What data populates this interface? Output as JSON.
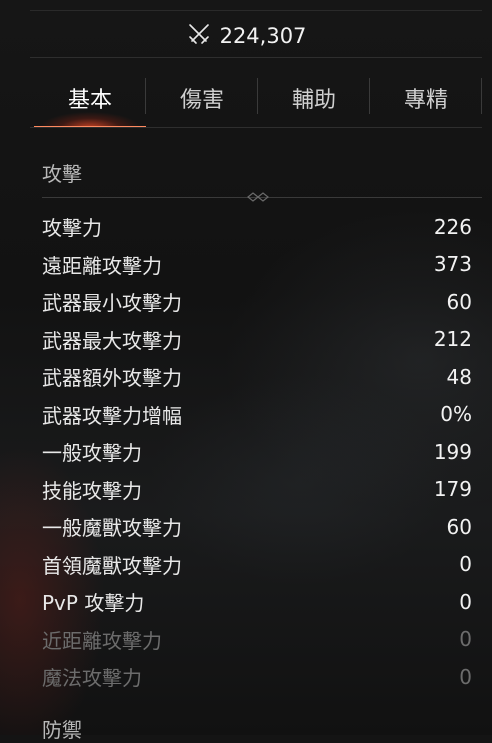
{
  "power": {
    "value": "224,307",
    "icon": "crossed-swords-icon"
  },
  "tabs": [
    {
      "label": "基本",
      "active": true
    },
    {
      "label": "傷害",
      "active": false
    },
    {
      "label": "輔助",
      "active": false
    },
    {
      "label": "專精",
      "active": false
    }
  ],
  "sections": {
    "attack": {
      "title": "攻擊"
    },
    "defense": {
      "title": "防禦"
    }
  },
  "stats": [
    {
      "label": "攻擊力",
      "value": "226"
    },
    {
      "label": "遠距離攻擊力",
      "value": "373"
    },
    {
      "label": "武器最小攻擊力",
      "value": "60"
    },
    {
      "label": "武器最大攻擊力",
      "value": "212"
    },
    {
      "label": "武器額外攻擊力",
      "value": "48"
    },
    {
      "label": "武器攻擊力增幅",
      "value": "0%"
    },
    {
      "label": "一般攻擊力",
      "value": "199"
    },
    {
      "label": "技能攻擊力",
      "value": "179"
    },
    {
      "label": "一般魔獸攻擊力",
      "value": "60"
    },
    {
      "label": "首領魔獸攻擊力",
      "value": "0"
    },
    {
      "label": "PvP 攻擊力",
      "value": "0"
    },
    {
      "label": "近距離攻擊力",
      "value": "0",
      "dim": true
    },
    {
      "label": "魔法攻擊力",
      "value": "0",
      "dim": true
    }
  ],
  "colors": {
    "accent": "#ff8a60",
    "dim_text": "#6c6c6c"
  }
}
